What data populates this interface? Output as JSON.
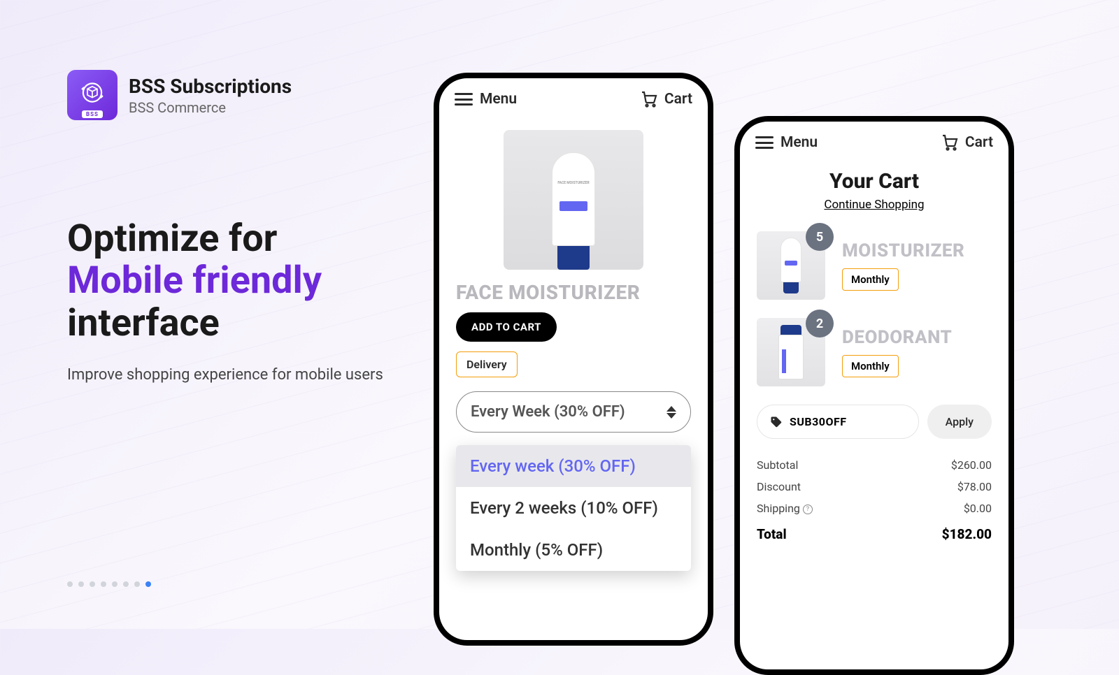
{
  "brand": {
    "title": "BSS Subscriptions",
    "subtitle": "BSS Commerce",
    "badge": "BSS"
  },
  "headline": {
    "line1": "Optimize for",
    "accent": "Mobile friendly",
    "line3": "interface"
  },
  "subhead": "Improve shopping experience for mobile users",
  "dots": {
    "count": 8,
    "active": 7
  },
  "phone1": {
    "menu": "Menu",
    "cart": "Cart",
    "product_title": "FACE MOISTURIZER",
    "add_to_cart": "ADD TO CART",
    "delivery_badge": "Delivery",
    "selected_freq": "Every Week (30% OFF)",
    "options": [
      "Every week (30% OFF)",
      "Every 2 weeks (10% OFF)",
      "Monthly (5% OFF)"
    ]
  },
  "phone2": {
    "menu": "Menu",
    "cart": "Cart",
    "cart_title": "Your Cart",
    "continue": "Continue Shopping",
    "items": [
      {
        "qty": "5",
        "name": "MOISTURIZER",
        "badge": "Monthly"
      },
      {
        "qty": "2",
        "name": "DEODORANT",
        "badge": "Monthly"
      }
    ],
    "promo_code": "SUB30OFF",
    "apply": "Apply",
    "totals": {
      "subtotal_label": "Subtotal",
      "subtotal": "$260.00",
      "discount_label": "Discount",
      "discount": "$78.00",
      "shipping_label": "Shipping",
      "shipping": "$0.00",
      "total_label": "Total",
      "total": "$182.00"
    }
  }
}
